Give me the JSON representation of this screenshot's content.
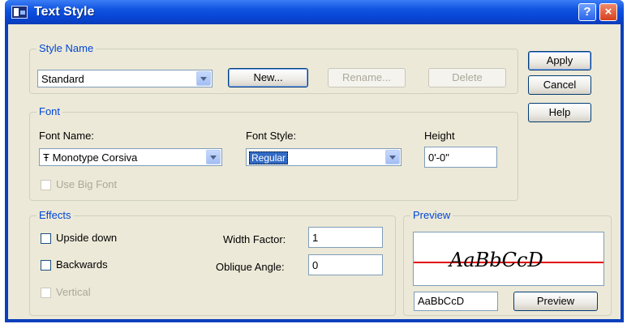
{
  "window": {
    "title": "Text Style"
  },
  "titlebar": {
    "help_glyph": "?",
    "close_glyph": "×"
  },
  "style_name": {
    "legend": "Style Name",
    "selected": "Standard",
    "new_label": "New...",
    "rename_label": "Rename...",
    "delete_label": "Delete"
  },
  "side_buttons": {
    "apply": "Apply",
    "cancel": "Cancel",
    "help": "Help"
  },
  "font": {
    "legend": "Font",
    "font_name_label": "Font Name:",
    "font_name_value": "Monotype Corsiva",
    "font_type_glyph": "Ŧ",
    "font_style_label": "Font Style:",
    "font_style_value": "Regular",
    "height_label": "Height",
    "height_value": "0'-0\"",
    "use_big_font": "Use Big Font"
  },
  "effects": {
    "legend": "Effects",
    "upside_down": "Upside down",
    "backwards": "Backwards",
    "vertical": "Vertical",
    "width_factor_label": "Width Factor:",
    "width_factor_value": "1",
    "oblique_angle_label": "Oblique Angle:",
    "oblique_angle_value": "0"
  },
  "preview": {
    "legend": "Preview",
    "sample_text": "AaBbCcD",
    "input_value": "AaBbCcD",
    "button_label": "Preview"
  },
  "colors": {
    "title_blue": "#0846d6",
    "legend_blue": "#0046d5",
    "dialog_bg": "#ece9d8",
    "preview_line": "#e00000"
  }
}
